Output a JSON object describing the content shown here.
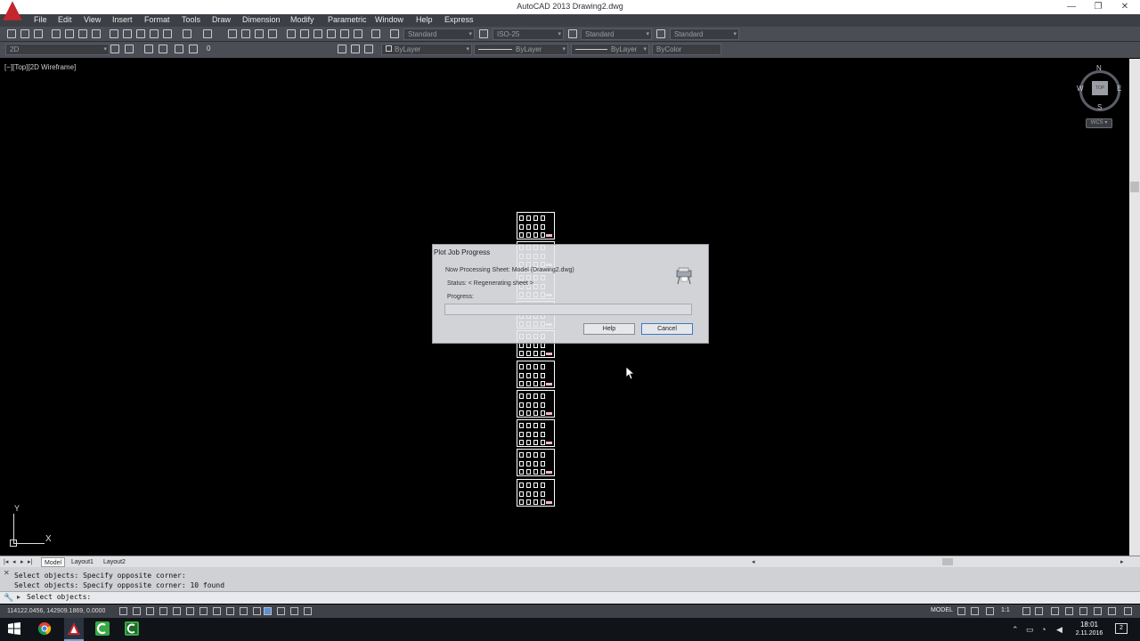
{
  "window": {
    "title": "AutoCAD 2013   Drawing2.dwg",
    "controls": [
      "—",
      "❐",
      "✕"
    ]
  },
  "menu": [
    "File",
    "Edit",
    "View",
    "Insert",
    "Format",
    "Tools",
    "Draw",
    "Dimension",
    "Modify",
    "Parametric",
    "Window",
    "Help",
    "Express"
  ],
  "toolbar": {
    "text_style": "Standard",
    "dim_style": "ISO-25",
    "table_style": "Standard",
    "mleader_style": "Standard",
    "workspace": "2D",
    "layer": "0",
    "color": "ByLayer",
    "linetype": "ByLayer",
    "lineweight": "ByLayer",
    "plot_style": "ByColor"
  },
  "viewport": {
    "label": "[−][Top][2D Wireframe]",
    "viewcube": {
      "top": "TOP",
      "n": "N",
      "s": "S",
      "e": "E",
      "w": "W",
      "wcs": "WCS ▾"
    }
  },
  "dialog": {
    "title": "Plot Job Progress",
    "sheet_line": "Now Processing Sheet: Model (Drawing2.dwg)",
    "status_line": "Status: < Regenerating sheet >",
    "progress_label": "Progress:",
    "progress": 0,
    "help_label": "Help",
    "cancel_label": "Cancel"
  },
  "ucs": {
    "y": "Y",
    "x": "X"
  },
  "tabs": [
    "Model",
    "Layout1",
    "Layout2"
  ],
  "command": {
    "history": [
      "Select objects: Specify opposite corner:",
      "Select objects: Specify opposite corner: 10 found"
    ],
    "prompt": "Select objects:"
  },
  "status": {
    "coords": "114122.0456, 142909.1869, 0.0000",
    "model": "MODEL",
    "scale": "1:1"
  },
  "taskbar": {
    "time": "18:01",
    "date": "2.11.2016",
    "notifications": "2"
  },
  "colors": {
    "accent_red": "#c4262e",
    "sheet_tag_pink": "#f4b8c8",
    "canvas": "#000000"
  },
  "sheet_count": 10
}
